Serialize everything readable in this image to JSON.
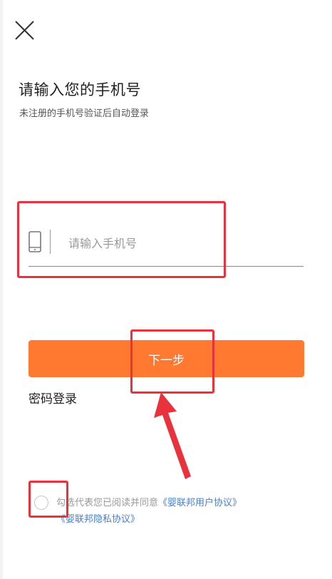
{
  "header": {
    "close_icon": "close-icon"
  },
  "login": {
    "title": "请输入您的手机号",
    "subtitle": "未注册的手机号验证后自动登录",
    "phone_placeholder": "请输入手机号",
    "phone_value": "",
    "next_label": "下一步",
    "password_login_label": "密码登录"
  },
  "agreement": {
    "checked": false,
    "prefix": "勾选代表您已阅读并同意",
    "user_agreement": "《婴联邦用户协议》",
    "privacy_agreement": "《婴联邦隐私协议》"
  },
  "colors": {
    "accent": "#ff7a30",
    "link": "#4a7fd0",
    "annotation": "#e8323c"
  }
}
